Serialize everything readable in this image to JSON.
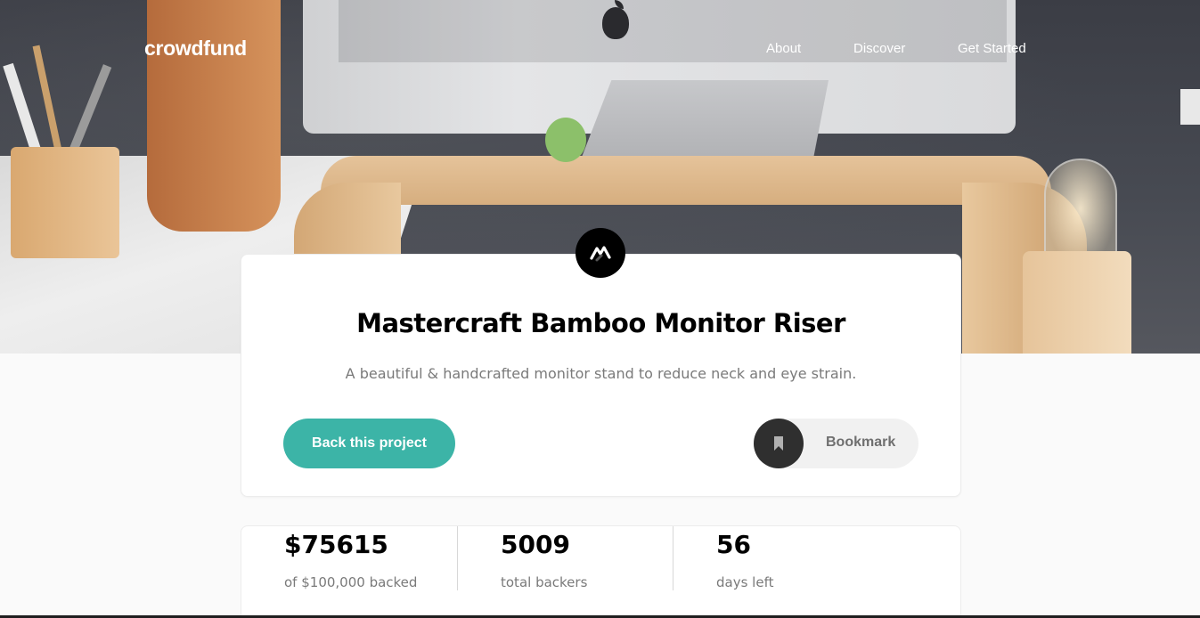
{
  "header": {
    "logo": "crowdfund",
    "nav": [
      "About",
      "Discover",
      "Get Started"
    ]
  },
  "hero": {
    "image": "desk-with-monitor-on-bamboo-riser"
  },
  "project": {
    "logo_icon": "mastercraft-logo-icon",
    "title": "Mastercraft Bamboo Monitor Riser",
    "subtitle": "A beautiful & handcrafted monitor stand to reduce neck and eye strain.",
    "back_label": "Back this project",
    "bookmark_label": "Bookmark",
    "bookmark_icon": "bookmark-icon"
  },
  "stats": [
    {
      "value": "$75615",
      "label": "of $100,000 backed"
    },
    {
      "value": "5009",
      "label": "total backers"
    },
    {
      "value": "56",
      "label": "days left"
    }
  ],
  "colors": {
    "accent": "#3cb4a7",
    "dark": "#2f2f2f",
    "text_muted": "#7a7a7a"
  }
}
